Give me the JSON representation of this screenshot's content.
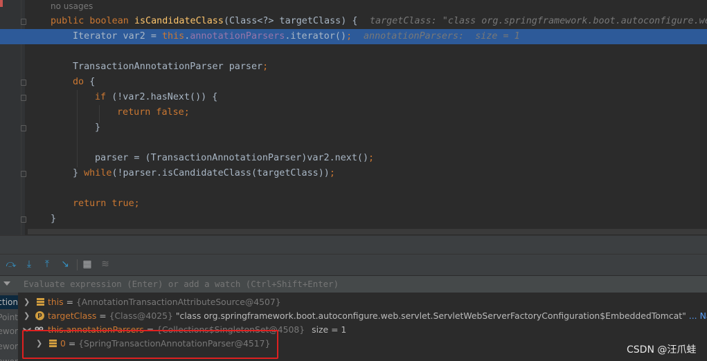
{
  "editor": {
    "usage_hint": "no usages",
    "lines": [
      {
        "parts": [
          [
            "kw",
            "public boolean "
          ],
          [
            "fn",
            "isCandidateClass"
          ],
          [
            "",
            "(Class<?> targetClass) {"
          ]
        ],
        "inline": "targetClass: \"class org.springframework.boot.autoconfigure.web."
      },
      {
        "parts": [
          [
            "",
            "Iterator var2 = "
          ],
          [
            "kw",
            "this"
          ],
          [
            "",
            "."
          ],
          [
            "fld",
            "annotationParsers"
          ],
          [
            "",
            ".iterator()"
          ],
          [
            "kw",
            ";"
          ]
        ],
        "inline": "annotationParsers:  size = 1"
      },
      {
        "parts": [],
        "inline": ""
      },
      {
        "parts": [
          [
            "",
            "TransactionAnnotationParser parser"
          ],
          [
            "kw",
            ";"
          ]
        ],
        "inline": ""
      },
      {
        "parts": [
          [
            "kw",
            "do "
          ],
          [
            "",
            "{"
          ]
        ],
        "inline": ""
      },
      {
        "parts": [
          [
            "kw",
            "if "
          ],
          [
            "",
            "(!var2.hasNext()) {"
          ]
        ],
        "inline": ""
      },
      {
        "parts": [
          [
            "kw",
            "return false;"
          ]
        ],
        "inline": ""
      },
      {
        "parts": [
          [
            "",
            "}"
          ]
        ],
        "inline": ""
      },
      {
        "parts": [],
        "inline": ""
      },
      {
        "parts": [
          [
            "",
            "parser = (TransactionAnnotationParser)var2.next()"
          ],
          [
            "kw",
            ";"
          ]
        ],
        "inline": ""
      },
      {
        "parts": [
          [
            "",
            "} "
          ],
          [
            "kw",
            "while"
          ],
          [
            "",
            "(!parser.isCandidateClass(targetClass))"
          ],
          [
            "kw",
            ";"
          ]
        ],
        "inline": ""
      },
      {
        "parts": [],
        "inline": ""
      },
      {
        "parts": [
          [
            "kw",
            "return true;"
          ]
        ],
        "inline": ""
      },
      {
        "parts": [
          [
            "",
            "}"
          ]
        ],
        "inline": ""
      }
    ]
  },
  "debugger": {
    "toolbar_icons": [
      "step-over-icon",
      "step-into-icon",
      "step-out-icon",
      "run-to-cursor-icon",
      "evaluate-table-icon",
      "trace-icon"
    ],
    "eval_placeholder": "Evaluate expression (Enter) or add a watch (Ctrl+Shift+Enter)",
    "frames": [
      "ction",
      "Point",
      "ewor",
      "ewor",
      "ewor"
    ],
    "variables": [
      {
        "name": "this",
        "type": "{AnnotationTransactionAttributeSource@4507}",
        "value": "",
        "extra": "",
        "link": "",
        "icon": "bars-icon"
      },
      {
        "name": "targetClass",
        "type": "{Class@4025}",
        "value": "\"class org.springframework.boot.autoconfigure.web.servlet.ServletWebServerFactoryConfiguration$EmbeddedTomcat\"",
        "extra": "...",
        "link": "Navigate",
        "icon": "p-icon"
      },
      {
        "name": "this.annotationParsers",
        "type": "{Collections$SingletonSet@4508}",
        "value": "",
        "extra": "size = 1",
        "link": "",
        "icon": "oo-icon"
      },
      {
        "name": "0",
        "type": "{SpringTransactionAnnotationParser@4517}",
        "value": "",
        "extra": "",
        "link": "",
        "icon": "bars-icon"
      }
    ]
  },
  "watermark": "CSDN @汪爪蛙"
}
